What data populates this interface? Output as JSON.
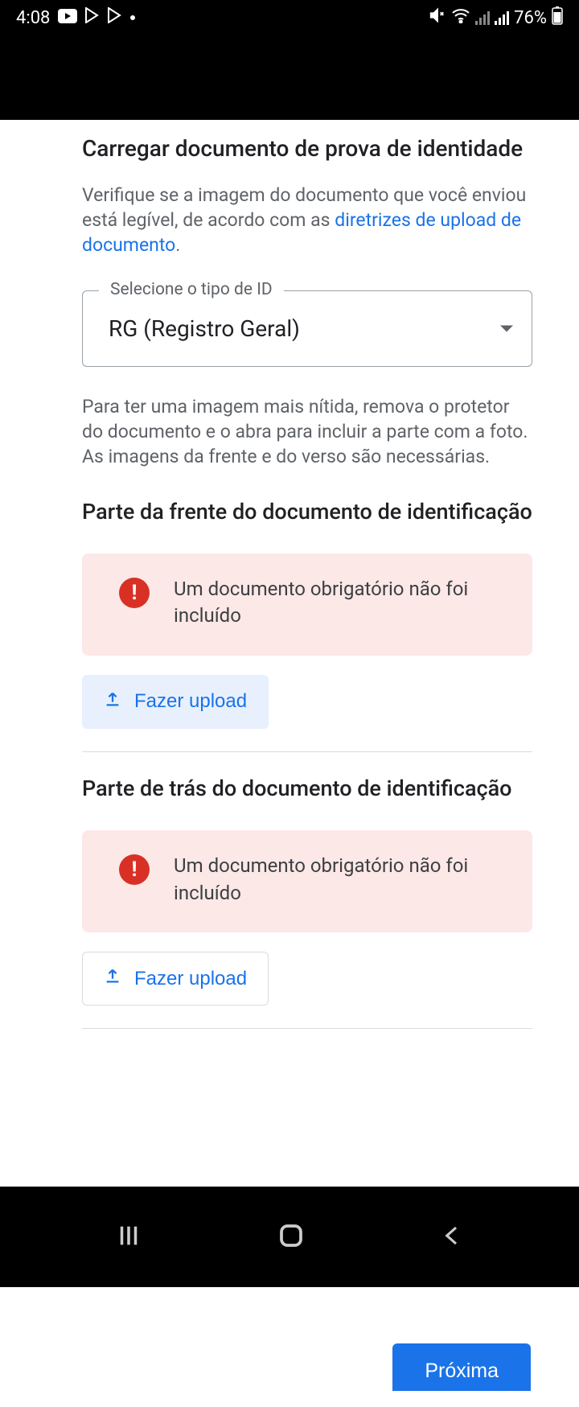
{
  "status": {
    "time": "4:08",
    "battery": "76%"
  },
  "page": {
    "title": "Carregar documento de prova de identidade",
    "verify_text_1": "Verifique se a imagem do documento que você enviou está legível, de acordo com as ",
    "guidelines_link": "diretrizes de upload de documento",
    "verify_text_2": ".",
    "select_label": "Selecione o tipo de ID",
    "select_value": "RG (Registro Geral)",
    "instruction": "Para ter uma imagem mais nítida, remova o protetor do documento e o abra para incluir a parte com a foto. As imagens da frente e do verso são necessárias.",
    "front": {
      "title": "Parte da frente do documento de identificação",
      "error": "Um documento obrigatório não foi incluído",
      "upload_label": "Fazer upload"
    },
    "back": {
      "title": "Parte de trás do documento de identificação",
      "error": "Um documento obrigatório não foi incluído",
      "upload_label": "Fazer upload"
    },
    "next_button": "Próxima"
  }
}
